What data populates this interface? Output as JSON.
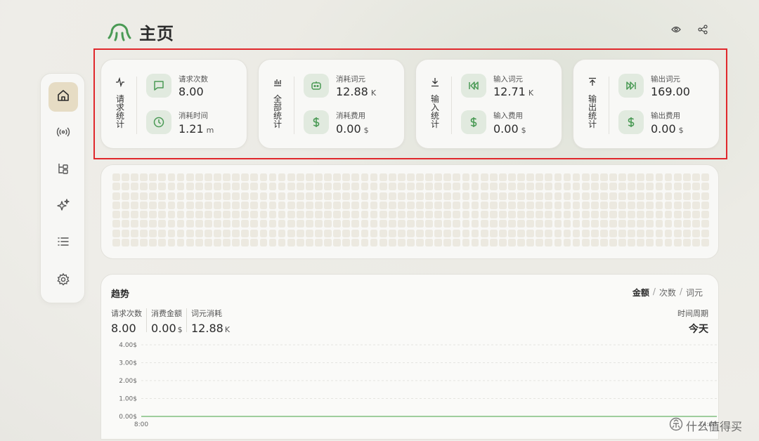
{
  "header": {
    "title": "主页",
    "logo_icon": "octopus-logo",
    "actions": [
      {
        "name": "eye-icon"
      },
      {
        "name": "share-icon"
      }
    ]
  },
  "sidebar": {
    "items": [
      {
        "icon": "home-icon",
        "active": true
      },
      {
        "icon": "broadcast-icon",
        "active": false
      },
      {
        "icon": "hierarchy-icon",
        "active": false
      },
      {
        "icon": "sparkle-icon",
        "active": false
      },
      {
        "icon": "list-icon",
        "active": false
      },
      {
        "icon": "gear-icon",
        "active": false
      }
    ]
  },
  "stat_cards": [
    {
      "label": "请求统计",
      "label_icon": "pulse-icon",
      "metrics": [
        {
          "icon": "message-icon",
          "label": "请求次数",
          "value": "8.00",
          "unit": ""
        },
        {
          "icon": "clock-icon",
          "label": "消耗时间",
          "value": "1.21",
          "unit": "m"
        }
      ]
    },
    {
      "label": "全部统计",
      "label_icon": "bar-chart-icon",
      "metrics": [
        {
          "icon": "robot-icon",
          "label": "消耗词元",
          "value": "12.88",
          "unit": "K"
        },
        {
          "icon": "dollar-icon",
          "label": "消耗费用",
          "value": "0.00",
          "unit": "$"
        }
      ]
    },
    {
      "label": "输入统计",
      "label_icon": "download-icon",
      "metrics": [
        {
          "icon": "rewind-icon",
          "label": "输入词元",
          "value": "12.71",
          "unit": "K"
        },
        {
          "icon": "dollar-icon",
          "label": "输入费用",
          "value": "0.00",
          "unit": "$"
        }
      ]
    },
    {
      "label": "输出统计",
      "label_icon": "upload-icon",
      "metrics": [
        {
          "icon": "fast-forward-icon",
          "label": "输出词元",
          "value": "169.00",
          "unit": ""
        },
        {
          "icon": "dollar-icon",
          "label": "输出费用",
          "value": "0.00",
          "unit": "$"
        }
      ]
    }
  ],
  "trend": {
    "title": "趋势",
    "tabs": [
      "金额",
      "次数",
      "词元"
    ],
    "active_tab": "金额",
    "summary": [
      {
        "label": "请求次数",
        "value": "8.00",
        "unit": ""
      },
      {
        "label": "消费金额",
        "value": "0.00",
        "unit": "$"
      },
      {
        "label": "词元消耗",
        "value": "12.88",
        "unit": "K"
      }
    ],
    "period_label": "时间周期",
    "period_value": "今天"
  },
  "chart_data": {
    "type": "area",
    "title": "",
    "xlabel": "",
    "ylabel": "",
    "y_ticks": [
      "4.00$",
      "3.00$",
      "2.00$",
      "1.00$",
      "0.00$"
    ],
    "ylim": [
      0,
      4
    ],
    "x": [
      "8:00",
      "14:00"
    ],
    "series": [
      {
        "values": [
          0,
          0
        ]
      }
    ],
    "grid": true,
    "line_color": "#7fbf7f"
  },
  "watermark": "什么值得买",
  "colors": {
    "accent_green": "#4a9a55",
    "icon_bg": "#e1eadf",
    "active_nav": "#e6dcc4",
    "highlight_red": "#e0282c"
  }
}
